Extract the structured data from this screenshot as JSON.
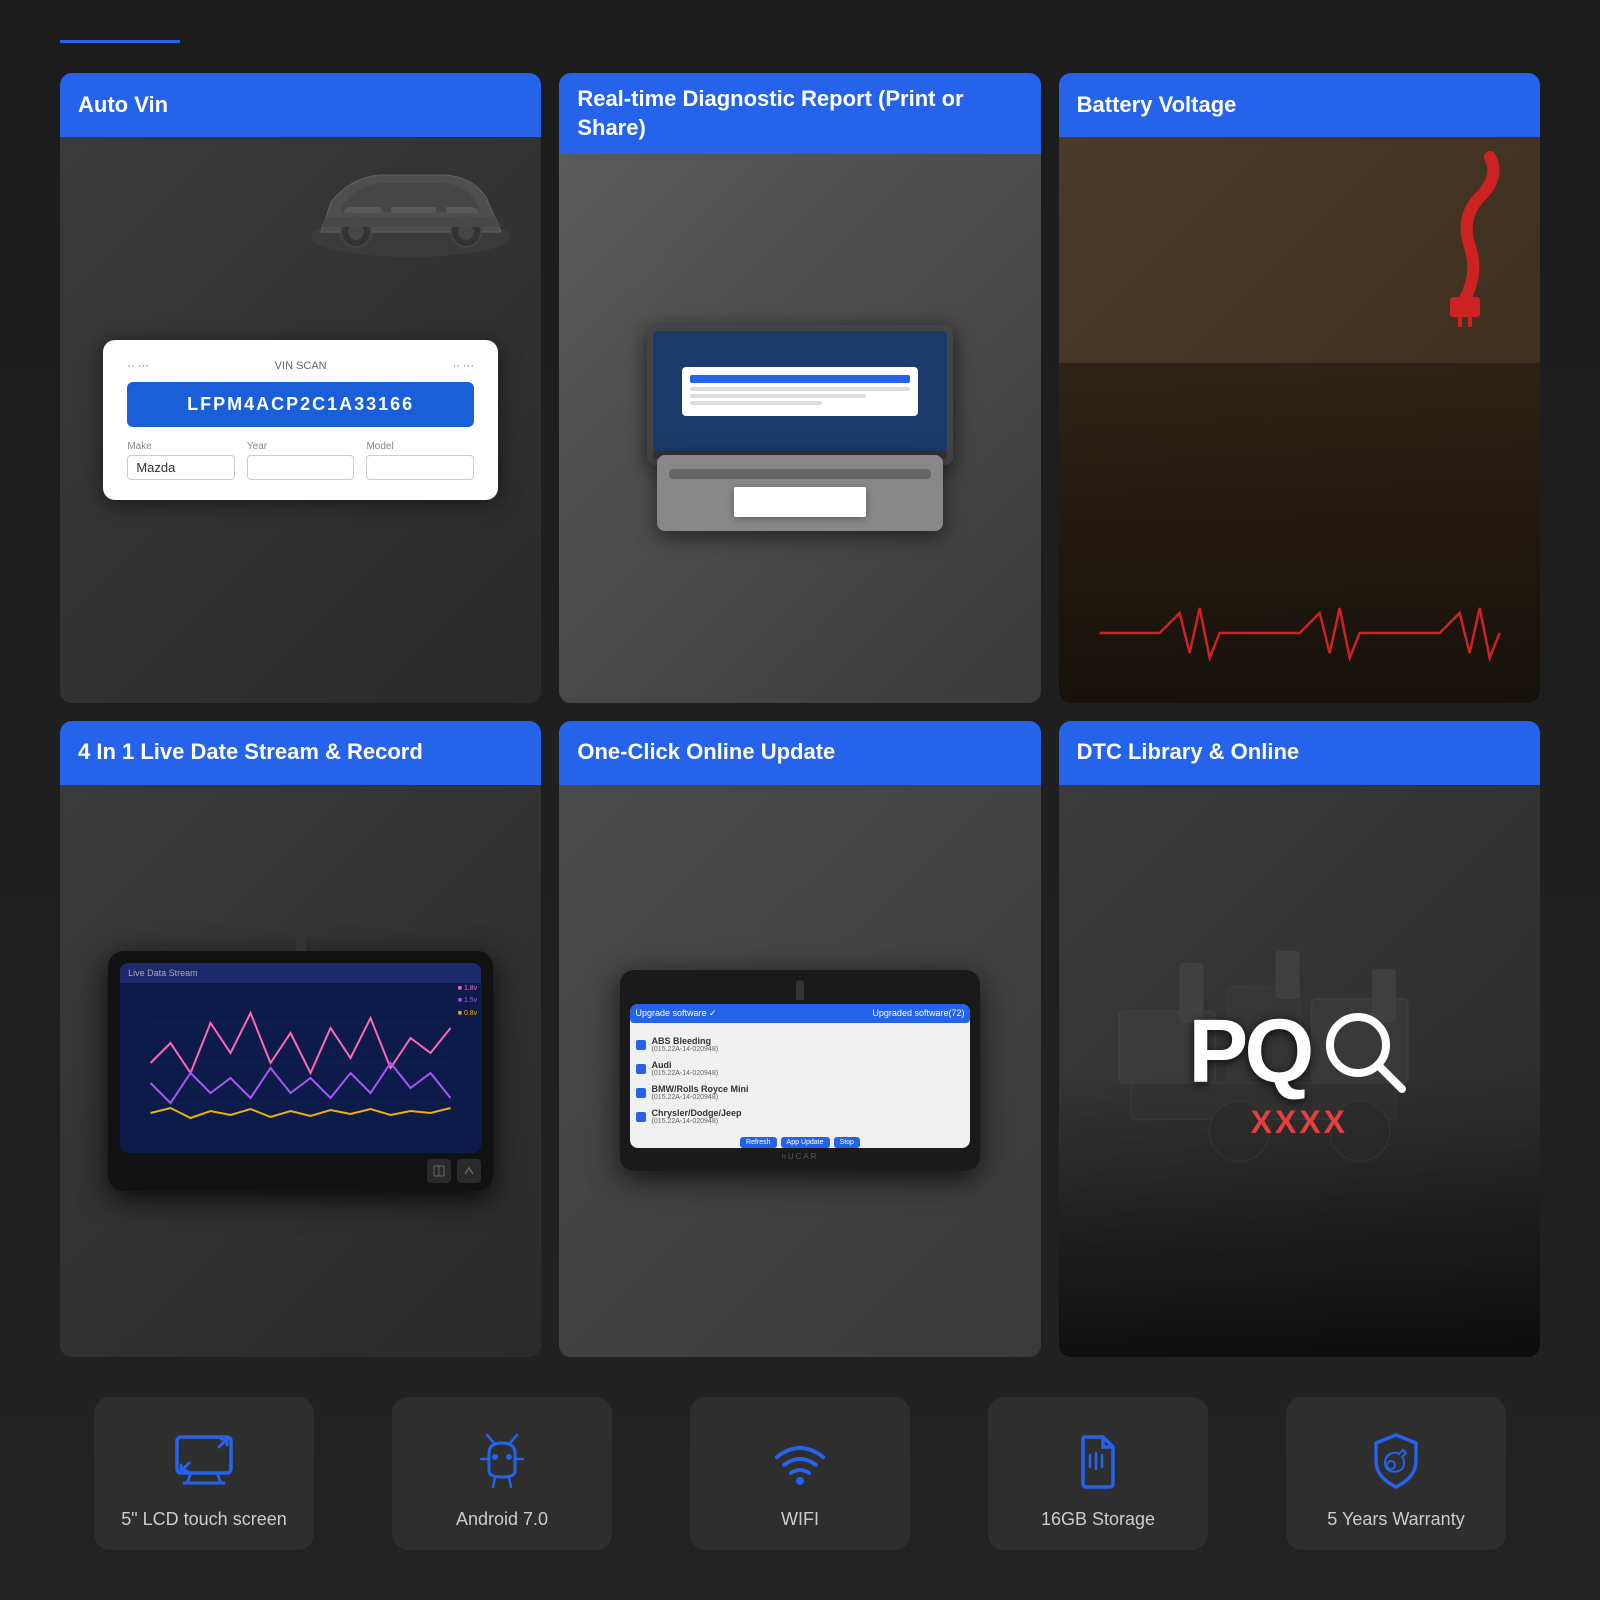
{
  "accent": {
    "color": "#2563eb"
  },
  "features": [
    {
      "id": "auto-vin",
      "label": "Auto Vin",
      "vin_scan_label": "VIN SCAN",
      "vin_number": "LFPM4ACP2C1A33166",
      "fields": [
        {
          "label": "Make",
          "value": "Mazda"
        },
        {
          "label": "Year",
          "value": ""
        },
        {
          "label": "Model",
          "value": ""
        }
      ]
    },
    {
      "id": "diagnostic-report",
      "label": "Real-time Diagnostic Report\n(Print or Share)"
    },
    {
      "id": "battery-voltage",
      "label": "Battery Voltage"
    },
    {
      "id": "live-stream",
      "label": "4 In 1 Live Date Stream & Record"
    },
    {
      "id": "one-click-update",
      "label": "One-Click Online Update",
      "update_items": [
        {
          "name": "ABS Bleeding",
          "version": "(015.22A-14-020948)"
        },
        {
          "name": "Audi",
          "version": "(015.22A-14-020948)"
        },
        {
          "name": "BMW/Rolls Royce Mini",
          "version": "(015.22A-14-020948)"
        },
        {
          "name": "Chrysler/Dodge/Jeep",
          "version": "(015.22A-14-020948)"
        }
      ]
    },
    {
      "id": "dtc-library",
      "label": "DTC Library & Online",
      "dtc_display": "PQ",
      "dtc_code": "XXXX"
    }
  ],
  "specs": [
    {
      "id": "lcd-screen",
      "label": "5\" LCD touch screen",
      "icon": "screen"
    },
    {
      "id": "android",
      "label": "Android 7.0",
      "icon": "android"
    },
    {
      "id": "wifi",
      "label": "WIFI",
      "icon": "wifi"
    },
    {
      "id": "storage",
      "label": "16GB Storage",
      "icon": "storage"
    },
    {
      "id": "warranty",
      "label": "5 Years Warranty",
      "icon": "warranty"
    }
  ]
}
